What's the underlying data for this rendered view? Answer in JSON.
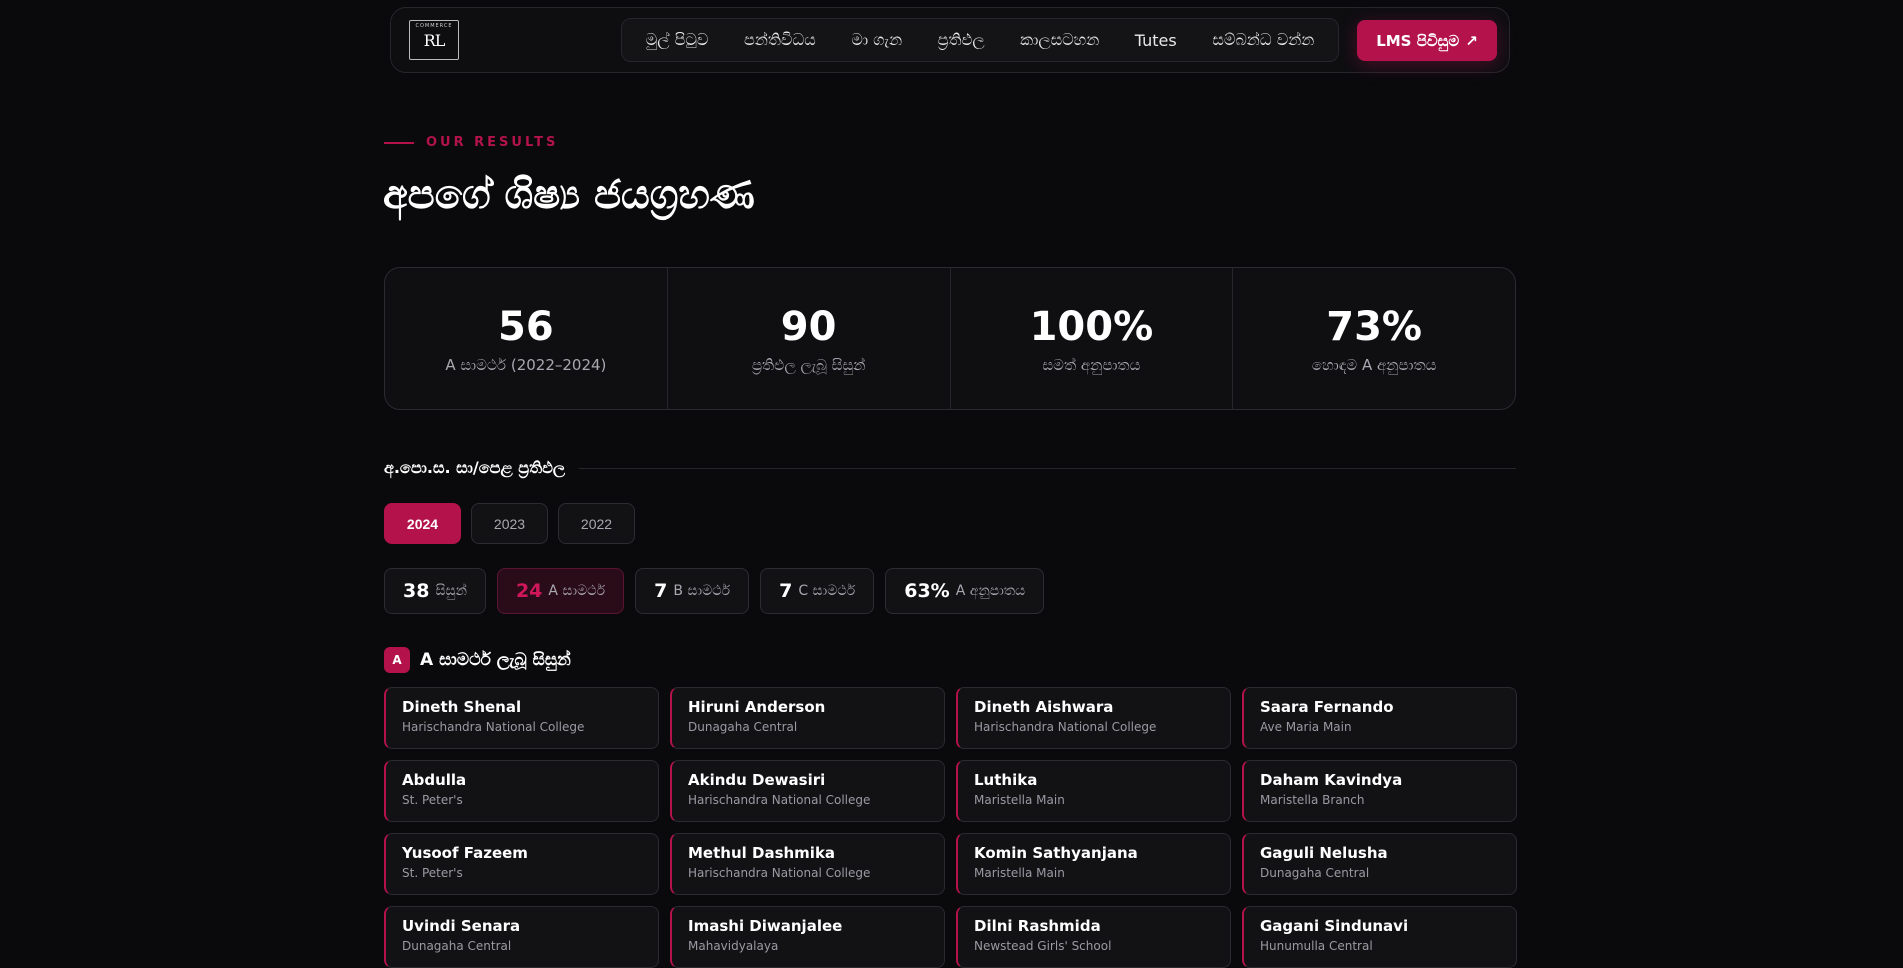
{
  "nav": {
    "logo_text": "RL",
    "logo_small": "COMMERCE",
    "items": [
      "මුල් පිටුව",
      "පන්තිවිධය",
      "මා ගැන",
      "ප්‍රතිඵල",
      "කාලසටහන",
      "Tutes",
      "සම්බන්ධ වන්න"
    ],
    "lms_label": "LMS පිවිසුම",
    "lms_arrow": "↗"
  },
  "results": {
    "eyebrow": "OUR RESULTS",
    "title": "අපගේ ශිෂ්‍ය ජයග්‍රහණ"
  },
  "stats": [
    {
      "value": "56",
      "label": "A සාමර්ථ (2022–2024)"
    },
    {
      "value": "90",
      "label": "ප්‍රතිඵල ලැබූ සිසුන්"
    },
    {
      "value": "100%",
      "label": "සමත් අනුපාතය"
    },
    {
      "value": "73%",
      "label": "හොඳම A අනුපාතය"
    }
  ],
  "section": {
    "title": "අ.පො.ස. සා/පෙළ ප්‍රතිඵල",
    "years": [
      "2024",
      "2023",
      "2022"
    ],
    "active_year": "2024"
  },
  "summary": [
    {
      "value": "38",
      "label": "සිසුන්"
    },
    {
      "value": "24",
      "label": "A සාමර්ථ"
    },
    {
      "value": "7",
      "label": "B සාමර්ථ"
    },
    {
      "value": "7",
      "label": "C සාමර්ථ"
    },
    {
      "value": "63%",
      "label": "A අනුපාතය"
    }
  ],
  "grade_a": {
    "badge": "A",
    "title": "A සාමර්ථ ලැබූ සිසුන්",
    "students": [
      {
        "name": "Dineth Shenal",
        "school": "Harischandra National College"
      },
      {
        "name": "Hiruni Anderson",
        "school": "Dunagaha Central"
      },
      {
        "name": "Dineth Aishwara",
        "school": "Harischandra National College"
      },
      {
        "name": "Saara Fernando",
        "school": "Ave Maria Main"
      },
      {
        "name": "Abdulla",
        "school": "St. Peter's"
      },
      {
        "name": "Akindu Dewasiri",
        "school": "Harischandra National College"
      },
      {
        "name": "Luthika",
        "school": "Maristella Main"
      },
      {
        "name": "Daham Kavindya",
        "school": "Maristella Branch"
      },
      {
        "name": "Yusoof Fazeem",
        "school": "St. Peter's"
      },
      {
        "name": "Methul Dashmika",
        "school": "Harischandra National College"
      },
      {
        "name": "Komin Sathyanjana",
        "school": "Maristella Main"
      },
      {
        "name": "Gaguli Nelusha",
        "school": "Dunagaha Central"
      },
      {
        "name": "Uvindi Senara",
        "school": "Dunagaha Central"
      },
      {
        "name": "Imashi Diwanjalee",
        "school": "Mahavidyalaya"
      },
      {
        "name": "Dilni Rashmida",
        "school": "Newstead Girls' School"
      },
      {
        "name": "Gagani Sindunavi",
        "school": "Hunumulla Central"
      }
    ]
  }
}
